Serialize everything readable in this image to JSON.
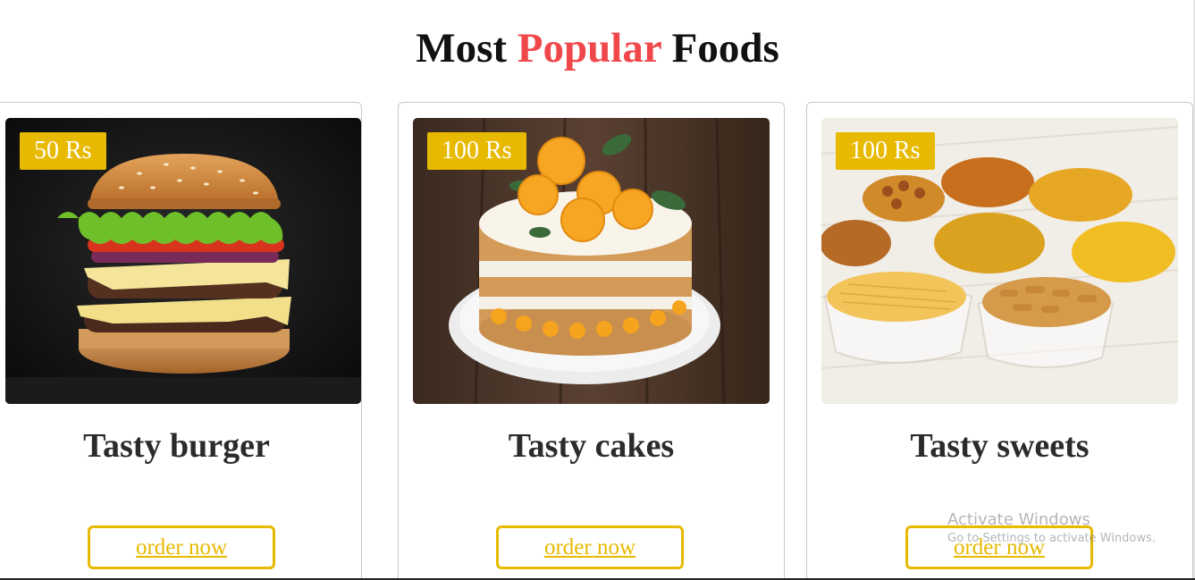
{
  "heading": {
    "before": "Most ",
    "accent": "Popular",
    "after": " Foods",
    "accent_color": "#f0474b"
  },
  "accent_color": "#e7b900",
  "cards": [
    {
      "price": "50 Rs",
      "title": "Tasty burger",
      "button": "order now",
      "image": "burger-photo"
    },
    {
      "price": "100 Rs",
      "title": "Tasty cakes",
      "button": "order now",
      "image": "orange-cake-photo"
    },
    {
      "price": "100 Rs",
      "title": "Tasty sweets",
      "button": "order now",
      "image": "indian-snacks-photo"
    }
  ],
  "watermark": {
    "title": "Activate Windows",
    "subtitle": "Go to Settings to activate Windows."
  }
}
